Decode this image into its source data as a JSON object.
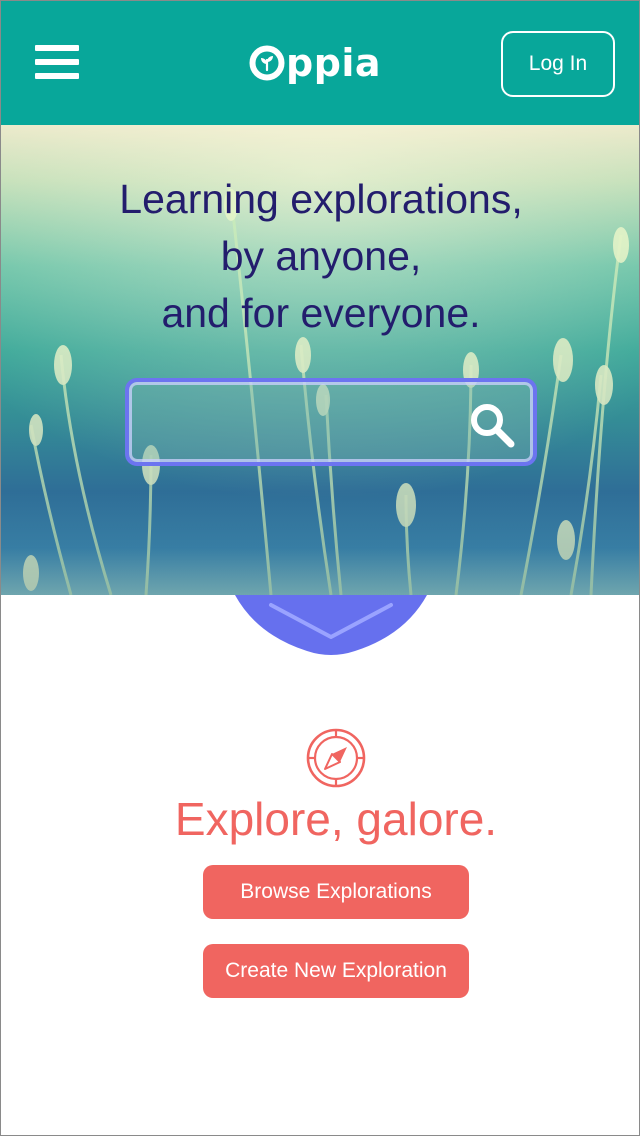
{
  "header": {
    "menu_icon": "hamburger-menu-icon",
    "logo_text": "ppia",
    "logo_icon": "sprout-o-logo",
    "login_label": "Log In",
    "background_color": "#08a79a"
  },
  "hero": {
    "headline_lines": [
      "Learning explorations,",
      "by anyone,",
      "and for everyone."
    ],
    "search": {
      "value": "",
      "placeholder": "",
      "icon": "search-icon"
    },
    "scroll_icon": "chevron-down-icon"
  },
  "explore": {
    "icon": "compass-icon",
    "title": "Explore, galore.",
    "browse_label": "Browse Explorations",
    "create_label": "Create New Exploration",
    "accent_color": "#f06560"
  }
}
